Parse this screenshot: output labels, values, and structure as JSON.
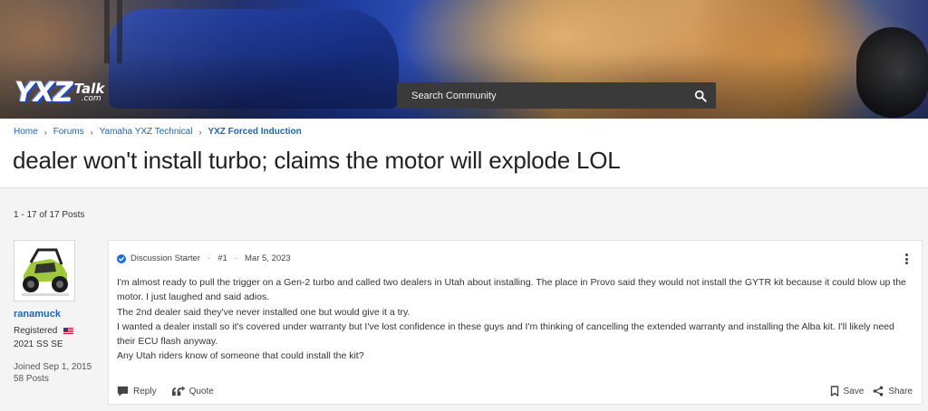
{
  "colors": {
    "link": "#1e63b8",
    "search_bg": "#3a3a3a",
    "page_bg": "#f4f4f4",
    "verified_badge": "#1e6fd9"
  },
  "banner": {
    "logo": {
      "main": "YXZ",
      "sub": "Talk",
      "domain": ".com"
    },
    "search": {
      "placeholder": "Search Community",
      "icon": "search-icon"
    }
  },
  "breadcrumb": {
    "items": [
      {
        "label": "Home"
      },
      {
        "label": "Forums"
      },
      {
        "label": "Yamaha YXZ Technical"
      },
      {
        "label": "YXZ Forced Induction"
      }
    ],
    "separator_icon": "chevron-right-icon"
  },
  "thread": {
    "title": "dealer won't install turbo; claims the motor will explode LOL",
    "post_count_label": "1 - 17 of 17 Posts"
  },
  "author": {
    "username": "ranamuck",
    "role": "Registered",
    "flag_icon": "us-flag-icon",
    "vehicle": "2021 SS SE",
    "joined": "Joined Sep 1, 2015",
    "posts": "58 Posts",
    "avatar_icon": "utv-avatar-icon"
  },
  "post": {
    "badge": "Discussion Starter",
    "number": "#1",
    "date": "Mar 5, 2023",
    "body": [
      "I'm almost ready to pull the trigger on a Gen-2 turbo and called two dealers in Utah about installing. The place in Provo said they would not install the GYTR kit because it could blow up the motor. I just laughed and said adios.",
      "The 2nd dealer said they've never installed one but would give it a try.",
      "I wanted a dealer install so it's covered under warranty but I've lost confidence in these guys and I'm thinking of cancelling the extended warranty and installing the Alba kit. I'll likely need their ECU flash anyway.",
      "Any Utah riders know of someone that could install the kit?"
    ],
    "actions": {
      "reply": "Reply",
      "quote": "Quote",
      "save": "Save",
      "share": "Share"
    }
  }
}
